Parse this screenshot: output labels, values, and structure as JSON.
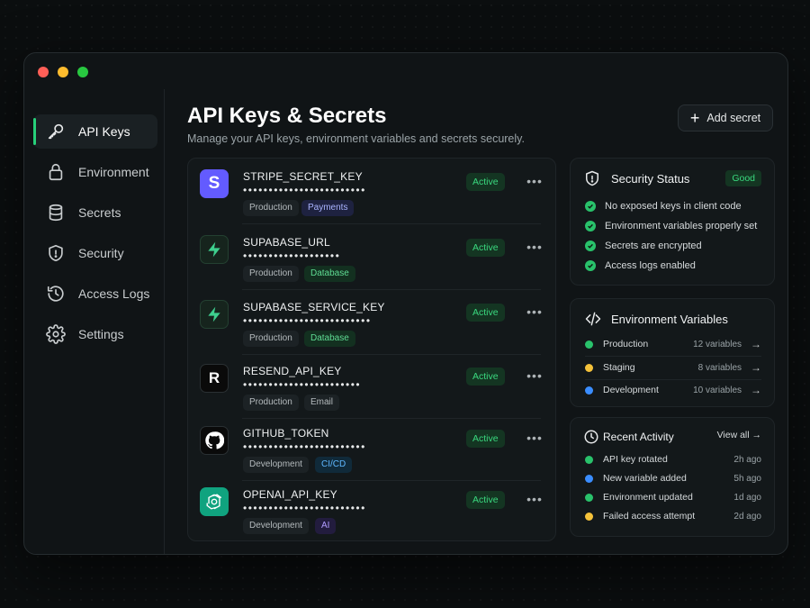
{
  "window": {
    "traffic_lights": [
      "close",
      "minimize",
      "maximize"
    ]
  },
  "sidebar": {
    "items": [
      {
        "label": "API Keys",
        "icon": "key-icon",
        "active": true
      },
      {
        "label": "Environment",
        "icon": "lock-icon"
      },
      {
        "label": "Secrets",
        "icon": "database-icon"
      },
      {
        "label": "Security",
        "icon": "shield-icon"
      },
      {
        "label": "Access Logs",
        "icon": "history-icon"
      },
      {
        "label": "Settings",
        "icon": "gear-icon"
      }
    ]
  },
  "header": {
    "title": "API Keys & Secrets",
    "subtitle": "Manage your API keys, environment variables and secrets securely.",
    "add_label": "Add secret"
  },
  "keys": [
    {
      "name": "STRIPE_SECRET_KEY",
      "mask": "••••••••••••••••••••••••",
      "status": "Active",
      "tags": [
        "Production",
        "Payments"
      ],
      "icon": "stripe-icon"
    },
    {
      "name": "SUPABASE_URL",
      "mask": "•••••••••••••••••••",
      "status": "Active",
      "tags": [
        "Production",
        "Database"
      ],
      "icon": "supabase-icon"
    },
    {
      "name": "SUPABASE_SERVICE_KEY",
      "mask": "•••••••••••••••••••••••••",
      "status": "Active",
      "tags": [
        "Production",
        "Database"
      ],
      "icon": "supabase-icon"
    },
    {
      "name": "RESEND_API_KEY",
      "mask": "•••••••••••••••••••••••",
      "status": "Active",
      "tags": [
        "Production",
        "Email"
      ],
      "icon": "resend-icon"
    },
    {
      "name": "GITHUB_TOKEN",
      "mask": "••••••••••••••••••••••••",
      "status": "Active",
      "tags": [
        "Development",
        "CI/CD"
      ],
      "icon": "github-icon"
    },
    {
      "name": "OPENAI_API_KEY",
      "mask": "••••••••••••••••••••••••",
      "status": "Active",
      "tags": [
        "Development",
        "AI"
      ],
      "icon": "openai-icon"
    }
  ],
  "security_status": {
    "title": "Security Status",
    "badge": "Good",
    "checks": [
      "No exposed keys in client code",
      "Environment variables properly set",
      "Secrets are encrypted",
      "Access logs enabled"
    ]
  },
  "environment_variables": {
    "title": "Environment Variables",
    "rows": [
      {
        "name": "Production",
        "count": "12 variables",
        "color": "#29c26b"
      },
      {
        "name": "Staging",
        "count": "8 variables",
        "color": "#f5c23a"
      },
      {
        "name": "Development",
        "count": "10 variables",
        "color": "#3a8dff"
      }
    ]
  },
  "recent_activity": {
    "title": "Recent Activity",
    "view_all": "View all",
    "items": [
      {
        "text": "API key rotated",
        "time": "2h ago",
        "color": "#29c26b"
      },
      {
        "text": "New variable added",
        "time": "5h ago",
        "color": "#3a8dff"
      },
      {
        "text": "Environment updated",
        "time": "1d ago",
        "color": "#29c26b"
      },
      {
        "text": "Failed access attempt",
        "time": "2d ago",
        "color": "#f5c23a"
      }
    ]
  }
}
